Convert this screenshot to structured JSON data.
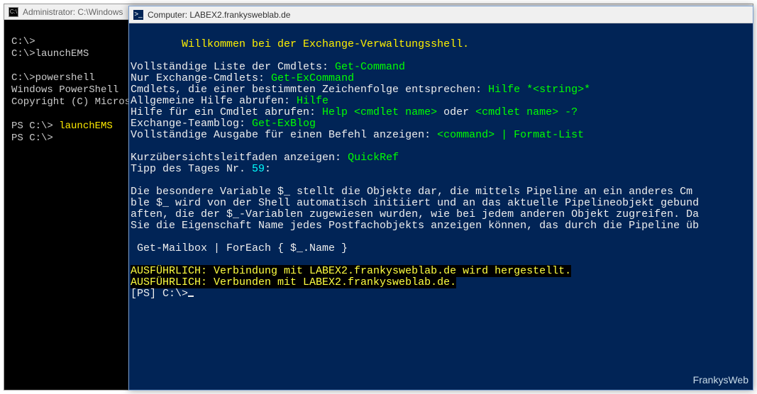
{
  "cmd": {
    "title": "Administrator: C:\\Windows",
    "lines": {
      "l1": "C:\\>",
      "l2": "C:\\>launchEMS",
      "l3": "",
      "l4": "C:\\>powershell",
      "l5": "Windows PowerShell",
      "l6": "Copyright (C) Microso",
      "l7": "",
      "l8_prompt": "PS C:\\> ",
      "l8_cmd": "launchEMS",
      "l9": "PS C:\\>"
    }
  },
  "ps": {
    "title": "Computer: LABEX2.frankysweblab.de",
    "ps_icon": ">_",
    "welcome": "        Willkommen bei der Exchange-Verwaltungsshell.",
    "r1a": "Vollständige Liste der Cmdlets: ",
    "r1b": "Get-Command",
    "r2a": "Nur Exchange-Cmdlets: ",
    "r2b": "Get-ExCommand",
    "r3a": "Cmdlets, die einer bestimmten Zeichenfolge entsprechen: ",
    "r3b": "Hilfe *<string>*",
    "r4a": "Allgemeine Hilfe abrufen: ",
    "r4b": "Hilfe",
    "r5a": "Hilfe für ein Cmdlet abrufen: ",
    "r5b": "Help <cmdlet name>",
    "r5c": " oder ",
    "r5d": "<cmdlet name> -?",
    "r6a": "Exchange-Teamblog: ",
    "r6b": "Get-ExBlog",
    "r7a": "Vollständige Ausgabe für einen Befehl anzeigen: ",
    "r7b": "<command> | Format-List",
    "r8a": "Kurzübersichtsleitfaden anzeigen: ",
    "r8b": "QuickRef",
    "tipline": "Tipp des Tages Nr. ",
    "tipnum": "59",
    "tipcolon": ":",
    "tip1": "Die besondere Variable $_ stellt die Objekte dar, die mittels Pipeline an ein anderes Cm",
    "tip2": "ble $_ wird von der Shell automatisch initiiert und an das aktuelle Pipelineobjekt gebund",
    "tip3": "aften, die der $_-Variablen zugewiesen wurden, wie bei jedem anderen Objekt zugreifen. Da",
    "tip4": "Sie die Eigenschaft Name jedes Postfachobjekts anzeigen können, das durch die Pipeline üb",
    "example": " Get-Mailbox | ForEach { $_.Name }",
    "v1": "AUSFÜHRLICH: Verbindung mit LABEX2.frankysweblab.de wird hergestellt.",
    "v2": "AUSFÜHRLICH: Verbunden mit LABEX2.frankysweblab.de.",
    "prompt": "[PS] C:\\>"
  },
  "watermark": "FrankysWeb"
}
